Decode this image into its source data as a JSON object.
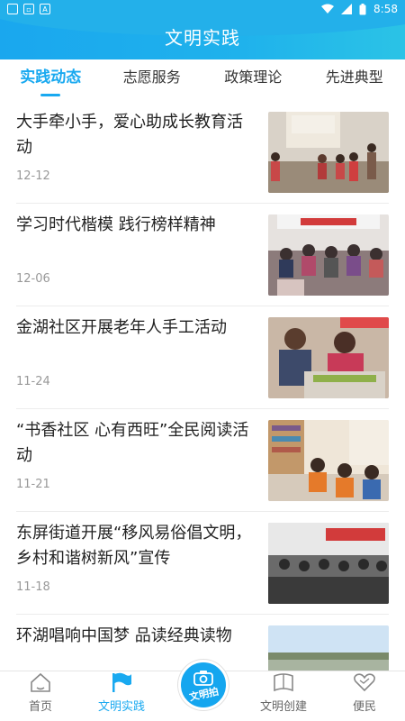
{
  "status_bar": {
    "time": "8:58"
  },
  "header": {
    "title": "文明实践"
  },
  "tabs": [
    "实践动态",
    "志愿服务",
    "政策理论",
    "先进典型"
  ],
  "news": [
    {
      "title": "大手牵小手，爱心助成长教育活动",
      "date": "12-12"
    },
    {
      "title": "学习时代楷模 践行榜样精神",
      "date": "12-06"
    },
    {
      "title": "金湖社区开展老年人手工活动",
      "date": "11-24"
    },
    {
      "title": "“书香社区 心有西旺”全民阅读活动",
      "date": "11-21"
    },
    {
      "title": "东屏街道开展“移风易俗倡文明，乡村和谐树新风”宣传",
      "date": "11-18"
    },
    {
      "title": "环湖唱响中国梦 品读经典读物",
      "date": ""
    }
  ],
  "bottom_nav": {
    "home": "首页",
    "practice": "文明实践",
    "center": "文明拍",
    "create": "文明创建",
    "service": "便民"
  },
  "colors": {
    "accent": "#19a9f0",
    "header": "#1fb2ec",
    "wave": "#f6c443"
  }
}
